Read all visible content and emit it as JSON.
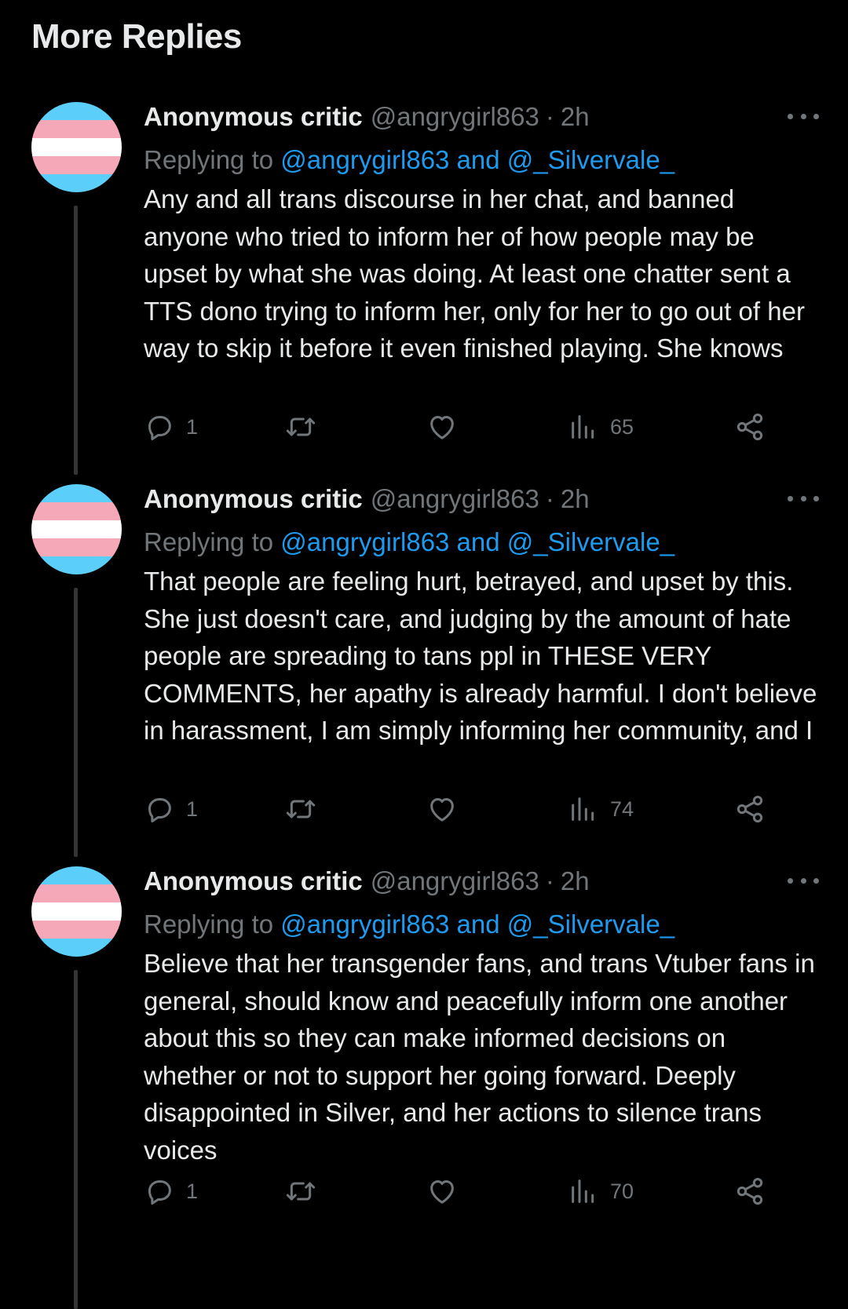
{
  "section_title": "More Replies",
  "avatar_flag_colors": [
    "#5bcefa",
    "#f5a9b8",
    "#ffffff",
    "#f5a9b8",
    "#5bcefa"
  ],
  "tweets": [
    {
      "author": "Anonymous critic",
      "handle": "@angrygirl863",
      "separator": "·",
      "time": "2h",
      "replying_prefix": "Replying to",
      "replying_mentions": "@angrygirl863 and @_Silvervale_",
      "text": "Any and all trans discourse in her chat, and banned anyone who tried to inform her of how people may be upset by what she was doing. At least one chatter sent a TTS dono trying to inform her, only for her to go out of her way to skip it before it even finished playing. She knows",
      "replies": "1",
      "views": "65"
    },
    {
      "author": "Anonymous critic",
      "handle": "@angrygirl863",
      "separator": "·",
      "time": "2h",
      "replying_prefix": "Replying to",
      "replying_mentions": "@angrygirl863 and @_Silvervale_",
      "text": "That people are feeling hurt, betrayed, and upset by this. She just doesn't care, and judging by the amount of hate people are spreading to tans ppl in THESE VERY COMMENTS, her apathy is already harmful. I don't believe in harassment, I am simply informing her community, and I",
      "replies": "1",
      "views": "74"
    },
    {
      "author": "Anonymous critic",
      "handle": "@angrygirl863",
      "separator": "·",
      "time": "2h",
      "replying_prefix": "Replying to",
      "replying_mentions": "@angrygirl863 and @_Silvervale_",
      "text": "Believe that her transgender fans, and trans Vtuber fans in general, should know and peacefully inform one another about this so they can make informed decisions on whether or not to support her going forward. Deeply disappointed in Silver, and her actions to silence trans voices",
      "replies": "1",
      "views": "70"
    }
  ]
}
